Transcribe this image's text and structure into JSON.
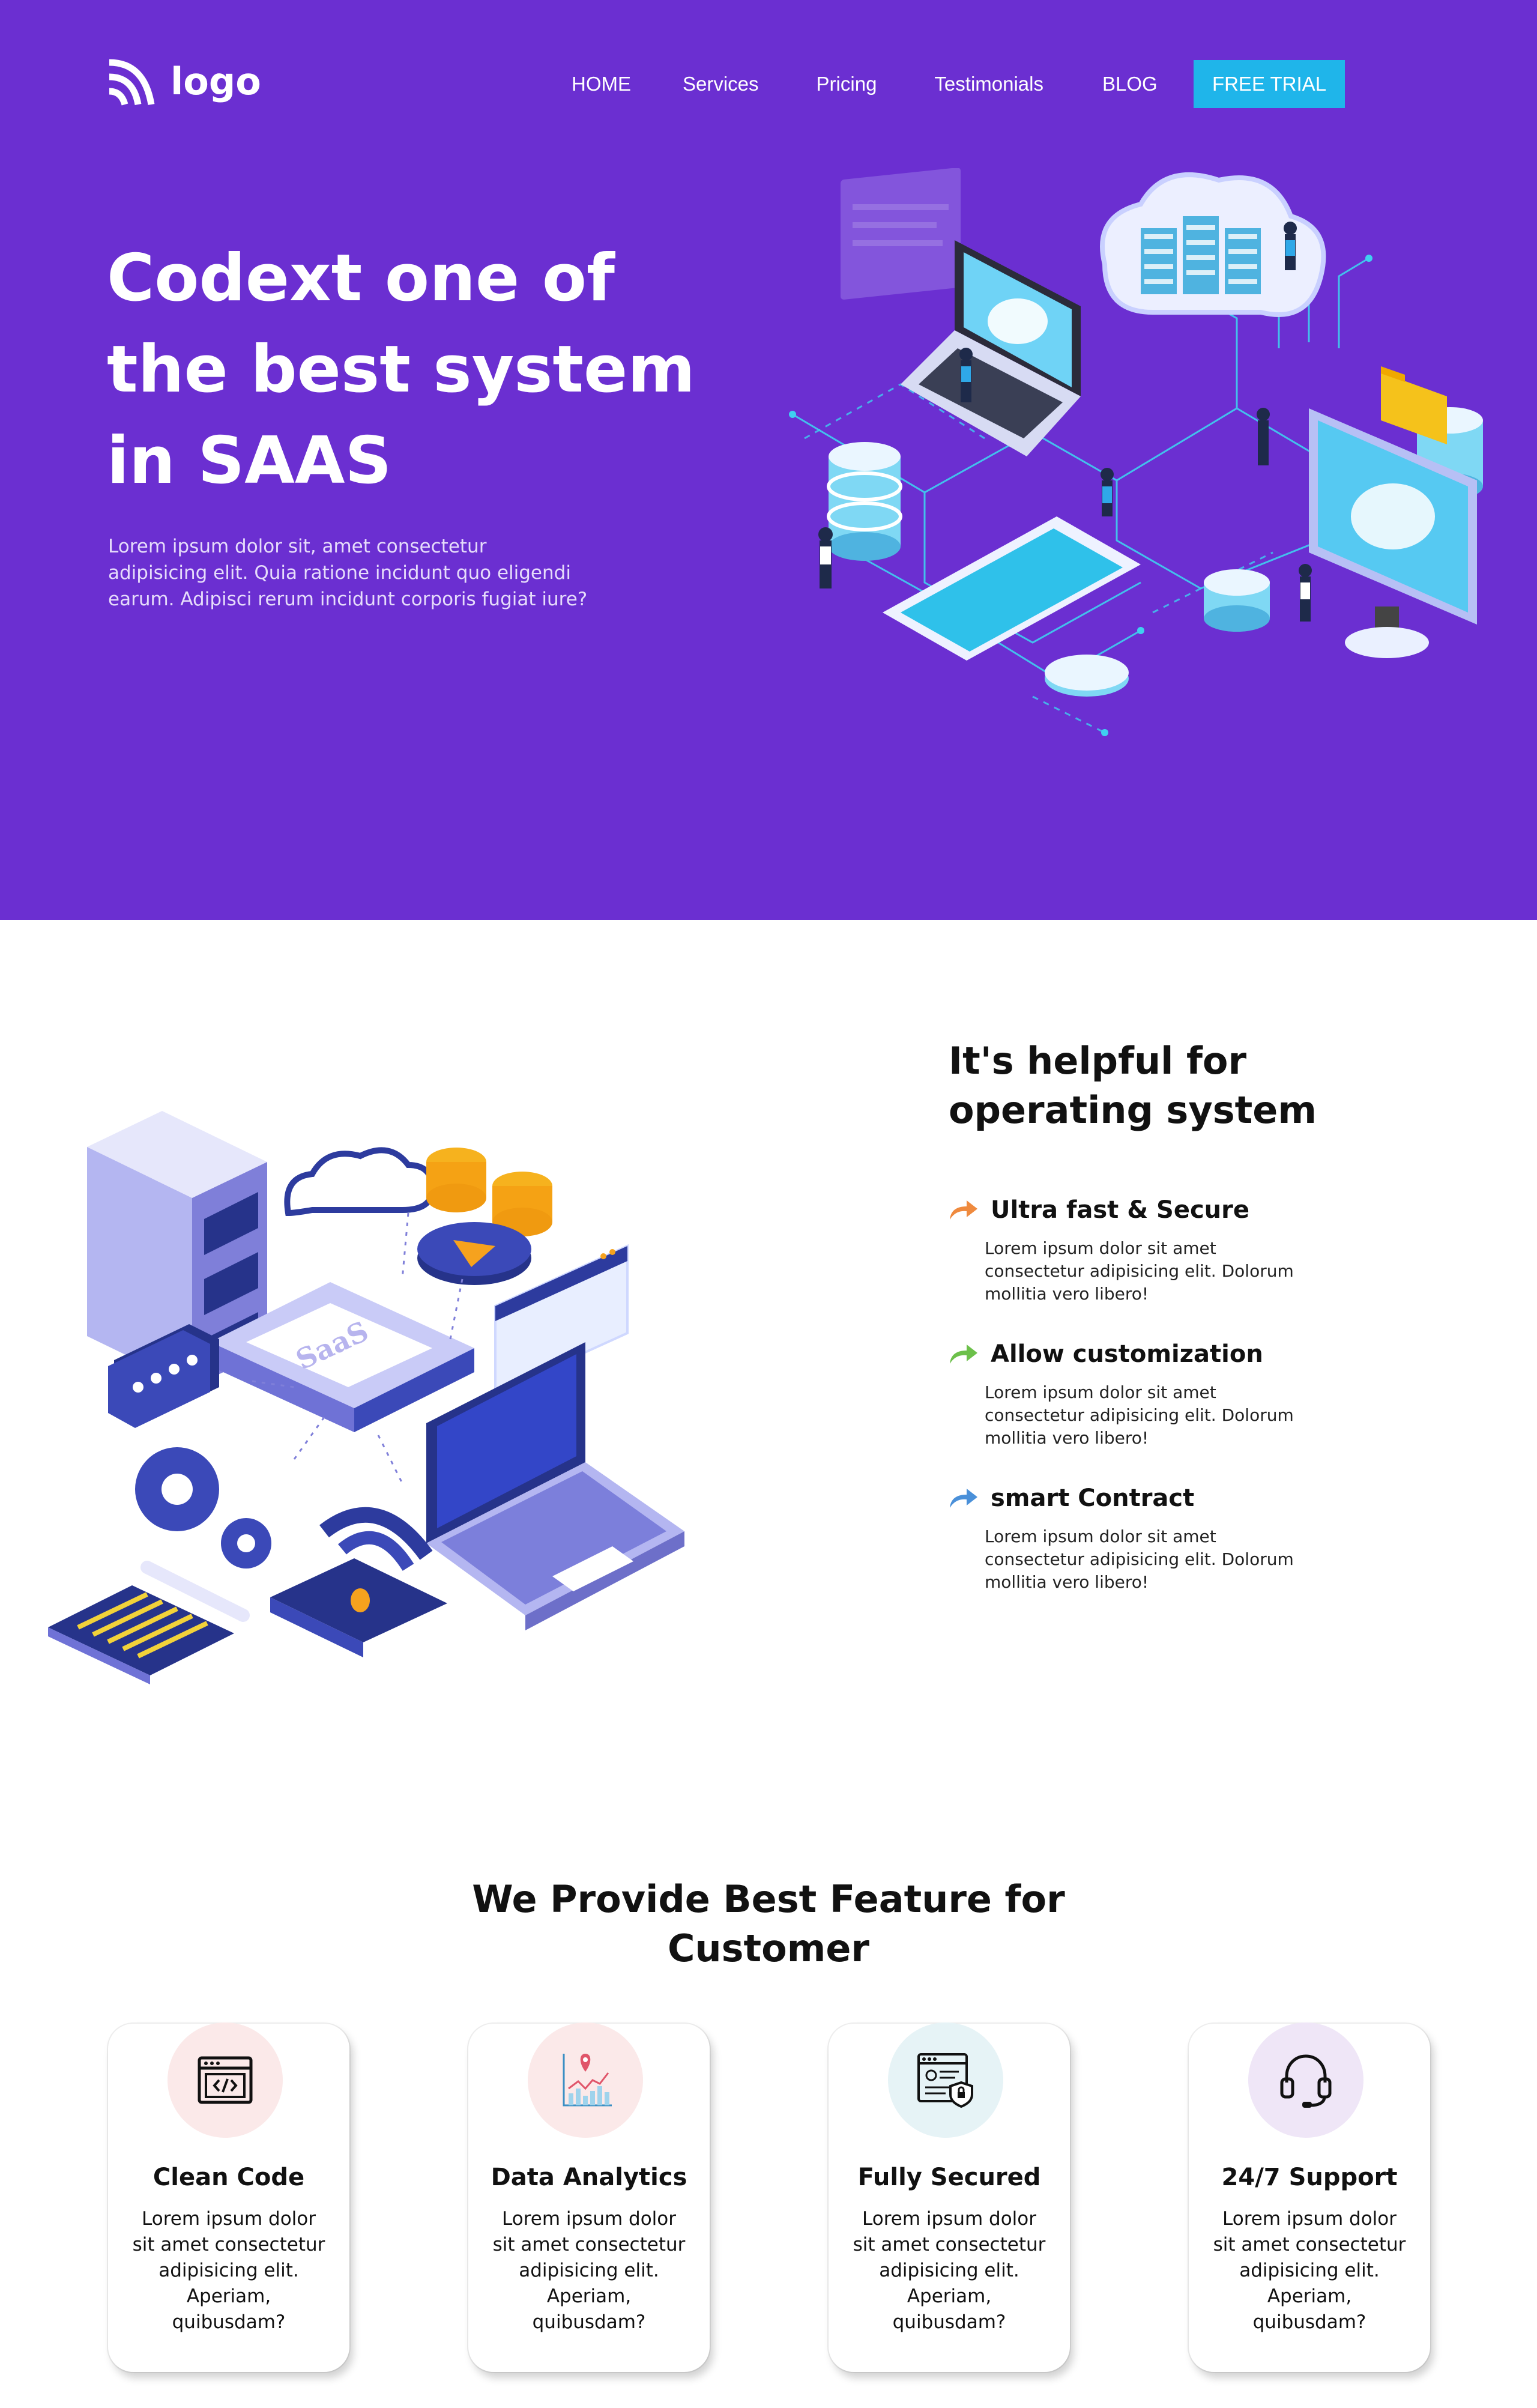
{
  "header": {
    "logo_text": "logo",
    "nav": [
      "HOME",
      "Services",
      "Pricing",
      "Testimonials",
      "BLOG"
    ],
    "cta_label": "FREE TRIAL"
  },
  "hero": {
    "title": "Codext one of the best system in SAAS",
    "text": "Lorem ipsum dolor sit, amet consectetur adipisicing elit. Quia ratione incidunt quo eligendi earum. Adipisci rerum incidunt corporis fugiat iure?",
    "background": "#6b2fd1"
  },
  "helpful": {
    "title": "It's helpful for operating system",
    "art_label": "SaaS",
    "features": [
      {
        "title": "Ultra fast & Secure",
        "text": "Lorem ipsum dolor sit amet consectetur adipisicing elit. Dolorum mollitia vero libero!",
        "arrow_color": "#ef8a3e",
        "icon": "arrow-icon"
      },
      {
        "title": "Allow customization",
        "text": "Lorem ipsum dolor sit amet consectetur adipisicing elit. Dolorum mollitia vero libero!",
        "arrow_color": "#6cc04a",
        "icon": "arrow-icon"
      },
      {
        "title": "smart Contract",
        "text": "Lorem ipsum dolor sit amet consectetur adipisicing elit. Dolorum mollitia vero libero!",
        "arrow_color": "#4a90d9",
        "icon": "arrow-icon"
      }
    ]
  },
  "features_section": {
    "title": "We Provide Best Feature for Customer",
    "cards": [
      {
        "title": "Clean Code",
        "text": "Lorem ipsum dolor sit amet consectetur adipisicing elit. Aperiam, quibusdam?",
        "icon": "code-window-icon",
        "icon_bg": "#fbe9e9"
      },
      {
        "title": "Data Analytics",
        "text": "Lorem ipsum dolor sit amet consectetur adipisicing elit. Aperiam, quibusdam?",
        "icon": "analytics-chart-icon",
        "icon_bg": "#fbe9e9"
      },
      {
        "title": "Fully Secured",
        "text": "Lorem ipsum dolor sit amet consectetur adipisicing elit. Aperiam, quibusdam?",
        "icon": "secure-browser-icon",
        "icon_bg": "#e6f3f6"
      },
      {
        "title": "24/7 Support",
        "text": "Lorem ipsum dolor sit amet consectetur adipisicing elit. Aperiam, quibusdam?",
        "icon": "headset-icon",
        "icon_bg": "#efe6f7"
      }
    ]
  }
}
